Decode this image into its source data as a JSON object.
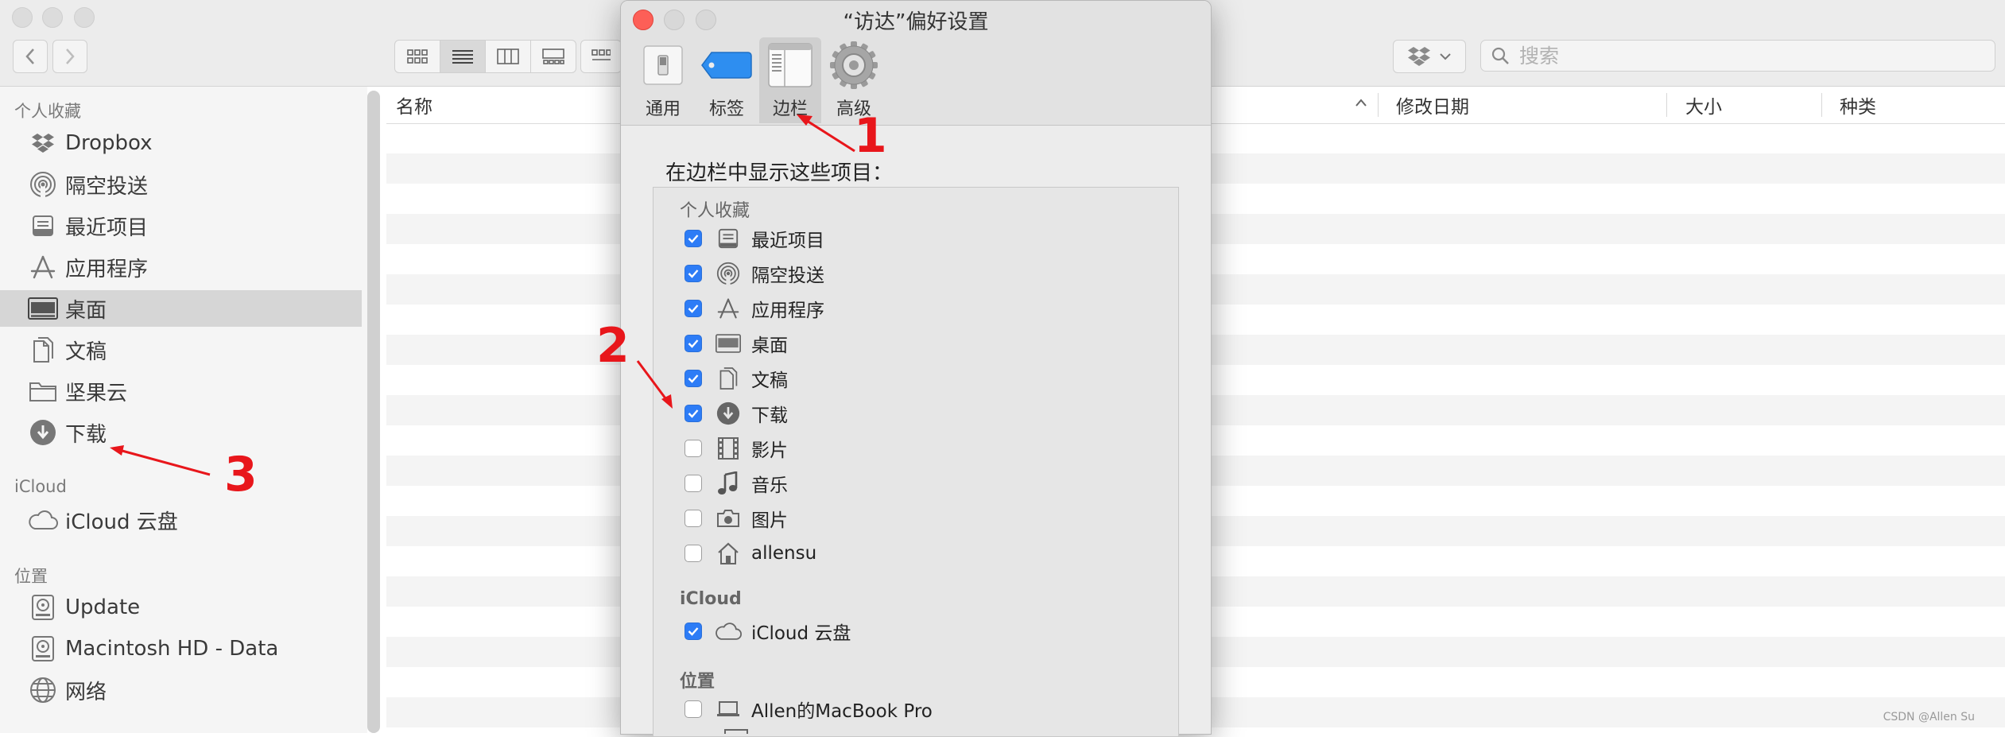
{
  "search": {
    "placeholder": "搜索"
  },
  "sidebar": {
    "sections": {
      "favorites": "个人收藏",
      "icloud": "iCloud",
      "locations": "位置"
    },
    "favorites": [
      {
        "label": "Dropbox",
        "icon": "dropbox-icon"
      },
      {
        "label": "隔空投送",
        "icon": "airdrop-icon"
      },
      {
        "label": "最近项目",
        "icon": "recents-icon"
      },
      {
        "label": "应用程序",
        "icon": "applications-icon"
      },
      {
        "label": "桌面",
        "icon": "desktop-icon",
        "selected": true
      },
      {
        "label": "文稿",
        "icon": "documents-icon"
      },
      {
        "label": "坚果云",
        "icon": "folder-icon"
      },
      {
        "label": "下载",
        "icon": "download-icon"
      }
    ],
    "icloud": [
      {
        "label": "iCloud 云盘",
        "icon": "cloud-icon"
      }
    ],
    "locations": [
      {
        "label": "Update",
        "icon": "disk-icon"
      },
      {
        "label": "Macintosh HD - Data",
        "icon": "disk-icon"
      },
      {
        "label": "网络",
        "icon": "network-icon"
      }
    ]
  },
  "list": {
    "columns": [
      "名称",
      "修改日期",
      "大小",
      "种类"
    ]
  },
  "prefs": {
    "title": "“访达”偏好设置",
    "tabs": [
      {
        "label": "通用",
        "icon": "switch-icon"
      },
      {
        "label": "标签",
        "icon": "tag-icon"
      },
      {
        "label": "边栏",
        "icon": "sidebar-icon",
        "active": true
      },
      {
        "label": "高级",
        "icon": "gear-icon"
      }
    ],
    "heading": "在边栏中显示这些项目：",
    "sections": {
      "favorites": "个人收藏",
      "icloud": "iCloud",
      "locations": "位置"
    },
    "favorites": [
      {
        "label": "最近项目",
        "icon": "recents-icon",
        "checked": true
      },
      {
        "label": "隔空投送",
        "icon": "airdrop-icon",
        "checked": true
      },
      {
        "label": "应用程序",
        "icon": "applications-icon",
        "checked": true
      },
      {
        "label": "桌面",
        "icon": "desktop-icon",
        "checked": true
      },
      {
        "label": "文稿",
        "icon": "documents-icon",
        "checked": true
      },
      {
        "label": "下载",
        "icon": "download-icon",
        "checked": true
      },
      {
        "label": "影片",
        "icon": "film-icon",
        "checked": false
      },
      {
        "label": "音乐",
        "icon": "music-icon",
        "checked": false
      },
      {
        "label": "图片",
        "icon": "camera-icon",
        "checked": false
      },
      {
        "label": "allensu",
        "icon": "home-icon",
        "checked": false
      }
    ],
    "icloud": [
      {
        "label": "iCloud 云盘",
        "icon": "cloud-icon",
        "checked": true
      }
    ],
    "locations": [
      {
        "label": "Allen的MacBook Pro",
        "icon": "laptop-icon",
        "checked": false
      }
    ]
  },
  "annotations": {
    "n1": "1",
    "n2": "2",
    "n3": "3"
  },
  "watermark": "CSDN @Allen Su",
  "colors": {
    "accent": "#2d7cf6",
    "annotation": "#e8161b",
    "close": "#fd5f57"
  }
}
